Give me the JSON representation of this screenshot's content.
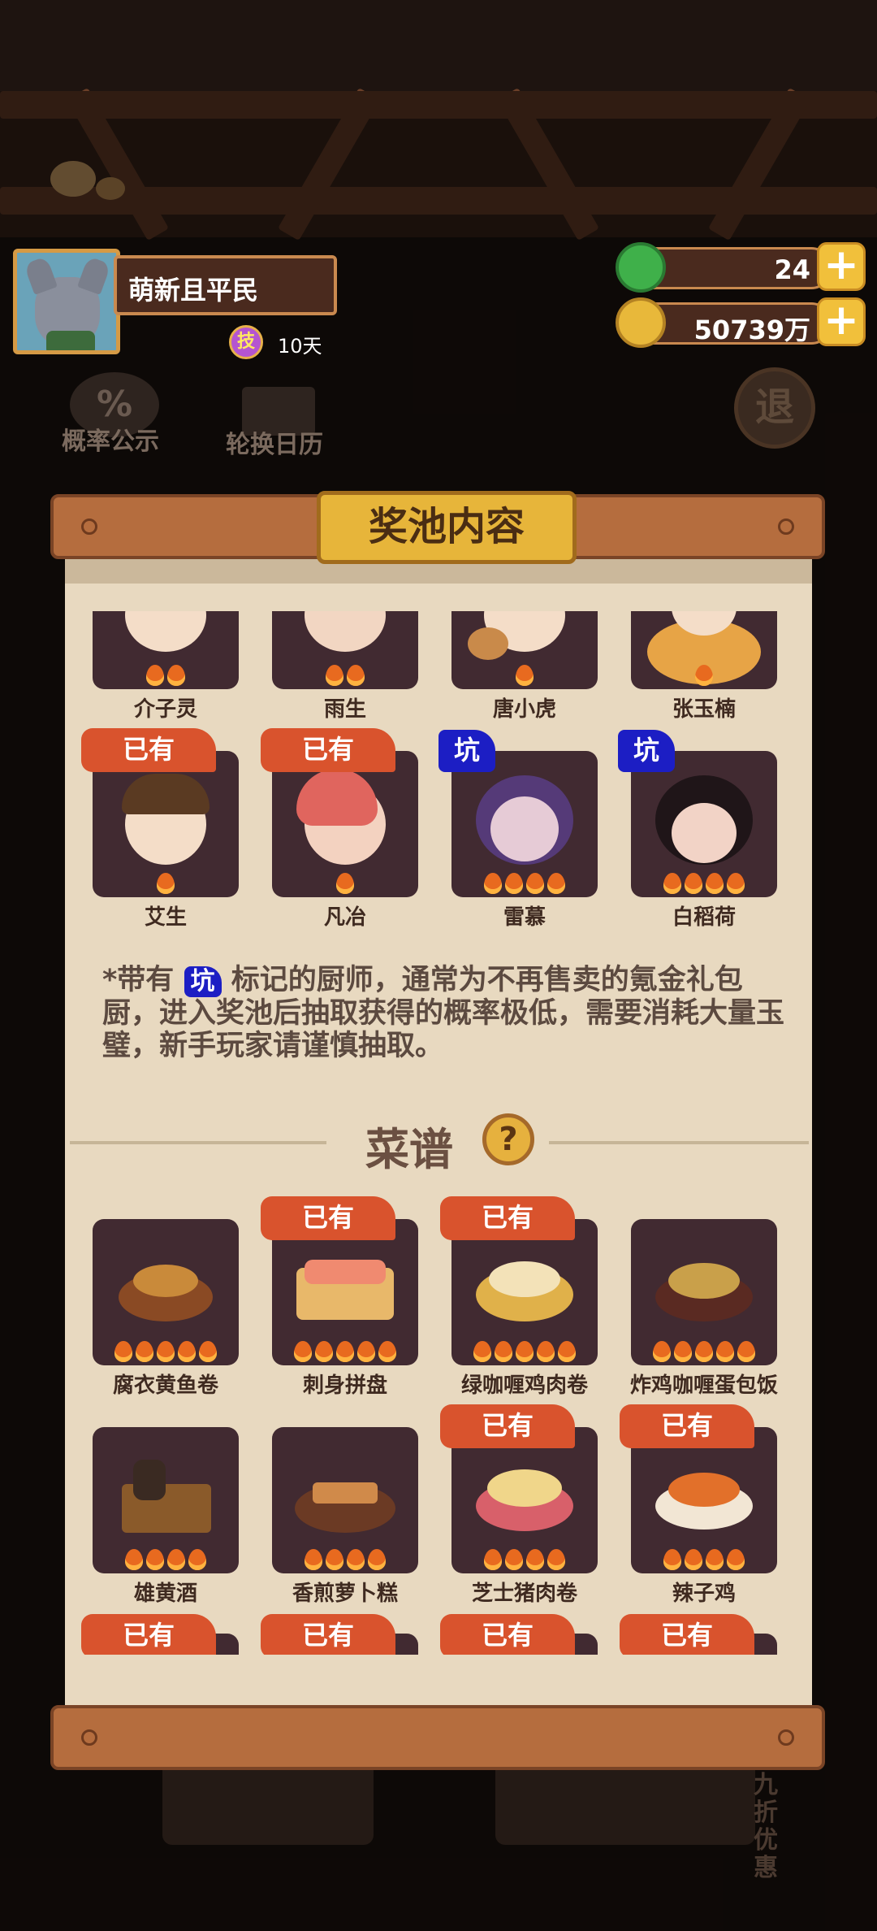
{
  "player": {
    "name": "萌新且平民",
    "badge_icon_text": "技",
    "badge_text": "10天"
  },
  "resources": {
    "jade": "24",
    "coins": "50739万",
    "plus": "+"
  },
  "background_buttons": {
    "probability": "概率公示",
    "probability_icon": "%",
    "calendar": "轮换日历",
    "exit": "退"
  },
  "panel": {
    "title": "奖池内容",
    "owned_tag": "已有",
    "keng_tag": "坑",
    "chefs_row1": [
      {
        "name": "介子灵",
        "stars": 2
      },
      {
        "name": "雨生",
        "stars": 2
      },
      {
        "name": "唐小虎",
        "stars": 1
      },
      {
        "name": "张玉楠",
        "stars": 1
      }
    ],
    "chefs_row2": [
      {
        "name": "艾生",
        "stars": 1,
        "tag": "已有"
      },
      {
        "name": "凡冶",
        "stars": 1,
        "tag": "已有"
      },
      {
        "name": "雷慕",
        "stars": 4,
        "tag": "坑"
      },
      {
        "name": "白稻荷",
        "stars": 4,
        "tag": "坑"
      }
    ],
    "note_prefix": "*带有",
    "note_suffix": "标记的厨师，通常为不再售卖的氪金礼包厨，进入奖池后抽取获得的概率极低，需要消耗大量玉璧，新手玩家请谨慎抽取。",
    "recipes_title": "菜谱",
    "help_icon": "?",
    "recipes_row1": [
      {
        "name": "腐衣黄鱼卷",
        "stars": 5
      },
      {
        "name": "刺身拼盘",
        "stars": 5,
        "tag": "已有"
      },
      {
        "name": "绿咖喱鸡肉卷",
        "stars": 5,
        "tag": "已有"
      },
      {
        "name": "炸鸡咖喱蛋包饭",
        "stars": 5
      }
    ],
    "recipes_row2": [
      {
        "name": "雄黄酒",
        "stars": 4
      },
      {
        "name": "香煎萝卜糕",
        "stars": 4
      },
      {
        "name": "芝士猪肉卷",
        "stars": 4,
        "tag": "已有"
      },
      {
        "name": "辣子鸡",
        "stars": 4,
        "tag": "已有"
      }
    ],
    "recipes_row3_tags": [
      "已有",
      "已有",
      "已有",
      "已有"
    ]
  },
  "background_bottom": {
    "discount": "九折优惠"
  },
  "colors": {
    "owned_tag": "#d9532d",
    "keng_tag": "#1c1ec4",
    "card_bg": "#412a31",
    "paper": "#e8d9c0",
    "title_plate": "#e7b53a"
  }
}
